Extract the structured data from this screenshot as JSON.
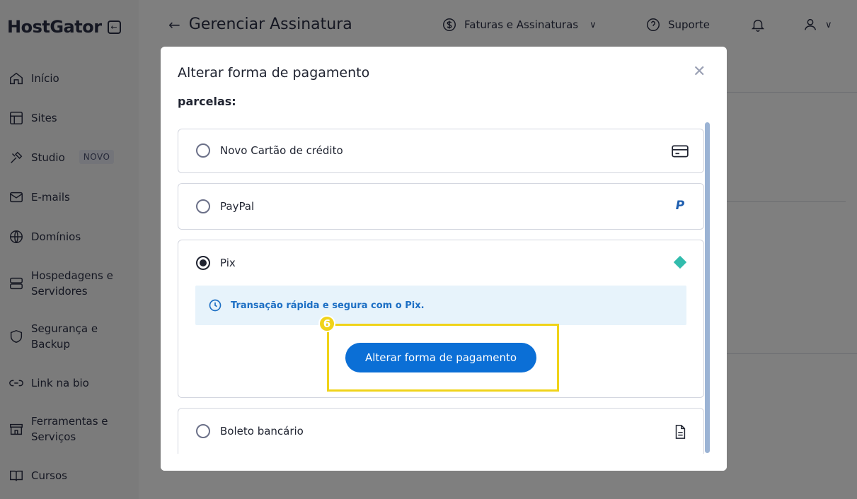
{
  "app": {
    "logo_text": "HostGator",
    "page_title": "Gerenciar Assinatura"
  },
  "topbar": {
    "invoices_label": "Faturas e Assinaturas",
    "support_label": "Suporte"
  },
  "sidebar": {
    "items": [
      {
        "label": "Início",
        "icon": "home-icon"
      },
      {
        "label": "Sites",
        "icon": "layout-icon"
      },
      {
        "label": "Studio",
        "icon": "tools-icon",
        "badge": "NOVO"
      },
      {
        "label": "E-mails",
        "icon": "mail-icon"
      },
      {
        "label": "Domínios",
        "icon": "globe-icon"
      },
      {
        "label": "Hospedagens e Servidores",
        "icon": "server-icon"
      },
      {
        "label": "Segurança e Backup",
        "icon": "shield-icon"
      },
      {
        "label": "Link na bio",
        "icon": "link-icon"
      },
      {
        "label": "Ferramentas e Serviços",
        "icon": "store-icon"
      },
      {
        "label": "Cursos",
        "icon": "book-icon"
      }
    ]
  },
  "modal": {
    "title": "Alterar forma de pagamento",
    "section_label": "parcelas:",
    "options": [
      {
        "label": "Novo Cartão de crédito",
        "icon": "credit-card-icon",
        "selected": false
      },
      {
        "label": "PayPal",
        "icon": "paypal-icon",
        "selected": false
      },
      {
        "label": "Pix",
        "icon": "pix-icon",
        "selected": true
      },
      {
        "label": "Boleto bancário",
        "icon": "document-icon",
        "selected": false
      }
    ],
    "pix_info": "Transação rápida e segura com o Pix.",
    "submit_label": "Alterar forma de pagamento",
    "step_number": "6"
  },
  "colors": {
    "primary": "#0b6fd6",
    "highlight": "#f0d31a",
    "info_bg": "#e7f3fb",
    "pix": "#32bcad"
  }
}
